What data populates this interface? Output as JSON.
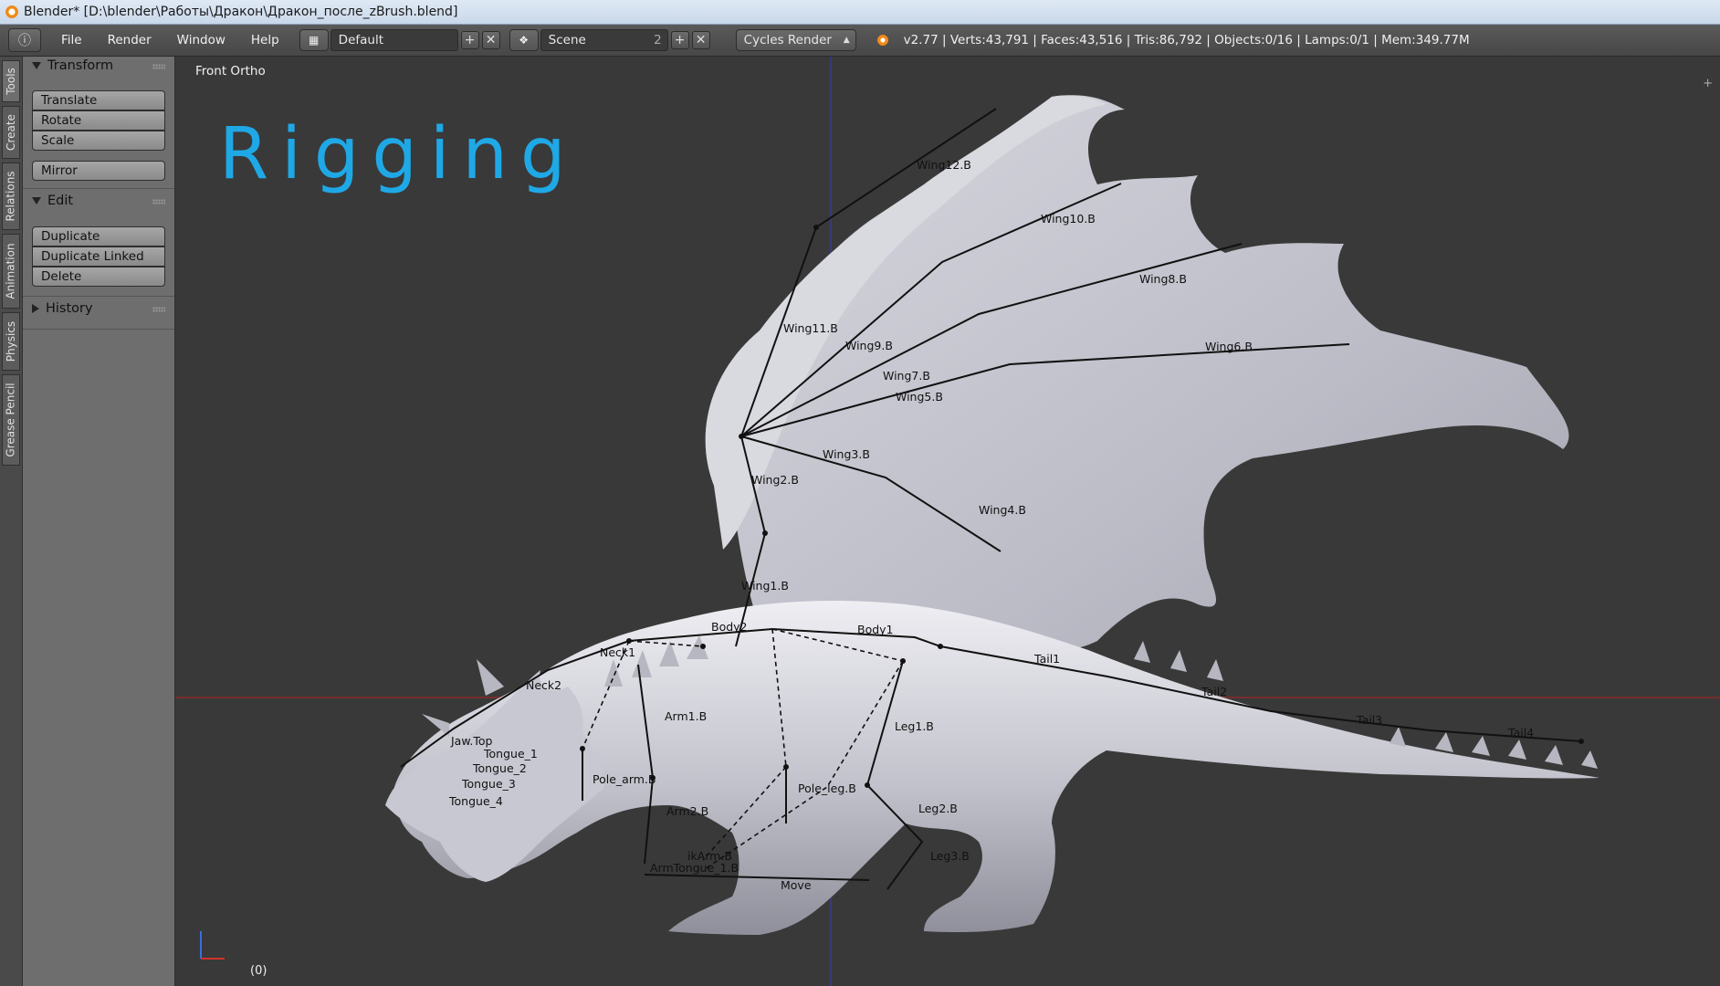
{
  "window": {
    "title": "Blender* [D:\\blender\\Работы\\Дракон\\Дракон_после_zBrush.blend]"
  },
  "header": {
    "menus": [
      "File",
      "Render",
      "Window",
      "Help"
    ],
    "screen_layout": "Default",
    "scene": "Scene",
    "scene_users": "2",
    "render_engine": "Cycles Render",
    "stats": "v2.77 | Verts:43,791 | Faces:43,516 | Tris:86,792 | Objects:0/16 | Lamps:0/1 | Mem:349.77M"
  },
  "tabs": [
    "Tools",
    "Create",
    "Relations",
    "Animation",
    "Physics",
    "Grease Pencil"
  ],
  "toolshelf": {
    "transform": {
      "title": "Transform",
      "buttons": [
        "Translate",
        "Rotate",
        "Scale"
      ],
      "mirror": "Mirror"
    },
    "edit": {
      "title": "Edit",
      "buttons": [
        "Duplicate",
        "Duplicate Linked",
        "Delete"
      ]
    },
    "history": {
      "title": "History"
    }
  },
  "viewport": {
    "view_name": "Front Ortho",
    "annotation": "Rigging",
    "frame": "(0)",
    "bones": [
      "Wing12.B",
      "Wing10.B",
      "Wing8.B",
      "Wing6.B",
      "Wing11.B",
      "Wing9.B",
      "Wing7.B",
      "Wing5.B",
      "Wing3.B",
      "Wing2.B",
      "Wing4.B",
      "Wing1.B",
      "Body2",
      "Body1",
      "Neck1",
      "Neck2",
      "Tail1",
      "Tail2",
      "Tail3",
      "Tail4",
      "Arm1.B",
      "Leg1.B",
      "Jaw.Top",
      "Tongue_1",
      "Tongue_2",
      "Tongue_3",
      "Tongue_4",
      "Pole_arm.B",
      "Pole_leg.B",
      "Arm2.B",
      "Leg2.B",
      "Leg3.B",
      "ikArm.B",
      "ArmTongue_1.B",
      "Move"
    ]
  },
  "colors": {
    "background": "#393939",
    "annotation": "#1fa8e6",
    "x_axis": "#8a2a2a",
    "z_axis": "#3a3a8a"
  }
}
